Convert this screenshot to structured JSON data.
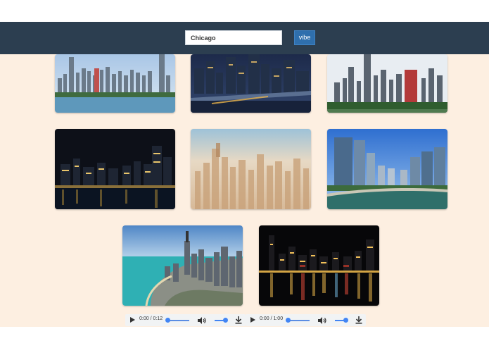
{
  "search": {
    "value": "Chicago",
    "placeholder": ""
  },
  "vibe_button": {
    "label": "vibe"
  },
  "colors": {
    "header_bg": "#2c3e50",
    "content_bg": "#fdefe1",
    "button_bg": "#2f6fad",
    "player_bg": "#f1f3f4",
    "player_accent": "#4285f4"
  },
  "gallery": {
    "images": [
      {
        "name": "skyline-lakefront-day"
      },
      {
        "name": "skyline-river-night-bridge"
      },
      {
        "name": "skyline-park-daytime"
      },
      {
        "name": "skyline-night-waterfront"
      },
      {
        "name": "skyline-aerial-hazy-sunrise"
      },
      {
        "name": "river-towers-blue-sky"
      },
      {
        "name": "aerial-lakeshore-turquoise"
      },
      {
        "name": "skyline-night-reflection"
      }
    ]
  },
  "audio_players": [
    {
      "time": "0:00 / 0:12",
      "icons": [
        "play-icon",
        "volume-icon",
        "download-icon"
      ]
    },
    {
      "time": "0:00 / 1:00",
      "icons": [
        "play-icon",
        "volume-icon",
        "download-icon"
      ]
    }
  ]
}
